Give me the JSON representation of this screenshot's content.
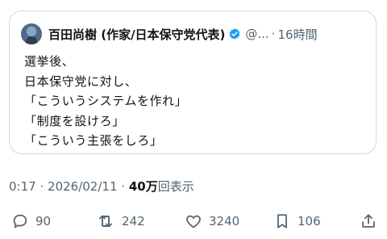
{
  "quote": {
    "author_name": "百田尚樹 (作家/日本保守党代表)",
    "handle": "@...",
    "separator": "·",
    "time": "16時間",
    "lines": [
      "選挙後、",
      "日本保守党に対し、",
      "「こういうシステムを作れ」",
      "「制度を設けろ」",
      "「こういう主張をしろ」"
    ]
  },
  "meta": {
    "time": "0:17",
    "separator1": "·",
    "date": "2026/02/11",
    "separator2": "·",
    "views_value": "40万",
    "views_label": "回表示"
  },
  "actions": {
    "reply_count": "90",
    "retweet_count": "242",
    "like_count": "3240",
    "bookmark_count": "106"
  },
  "colors": {
    "verified_badge": "#1d9bf0",
    "secondary_text": "#536471",
    "border": "#cfd9de"
  }
}
